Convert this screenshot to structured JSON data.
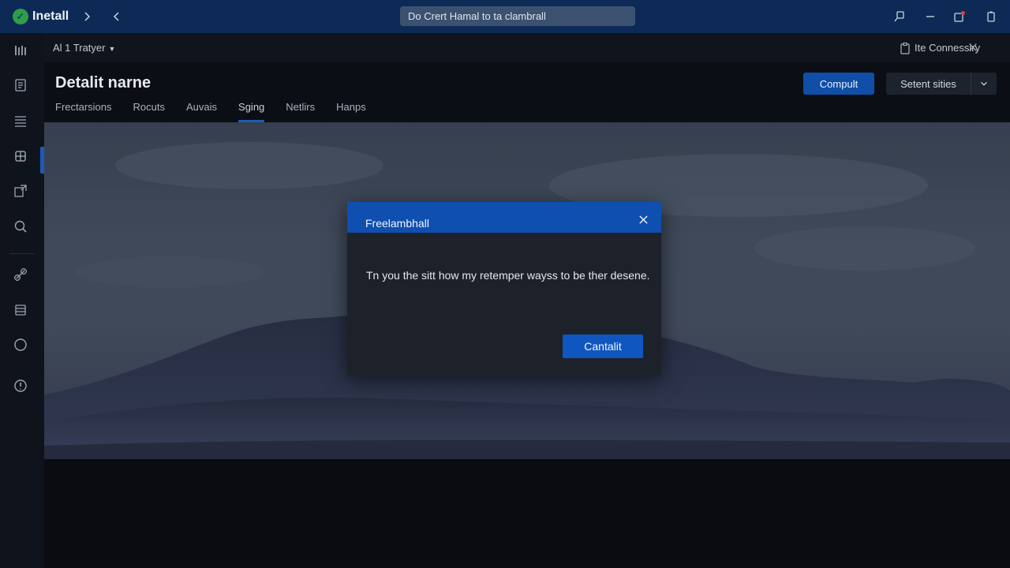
{
  "titlebar": {
    "app_name": "Inetall",
    "search_value": "Do Crert Hamal to ta clambrall"
  },
  "subheader": {
    "filter_label": "Al 1 Tratyer",
    "connect_label": "Ite Connessiry"
  },
  "page": {
    "title": "Detalit narne",
    "primary_button": "Compult",
    "split_button": "Setent sities",
    "tabs": [
      {
        "label": "Frectarsions"
      },
      {
        "label": "Rocuts"
      },
      {
        "label": "Auvais"
      },
      {
        "label": "Sging"
      },
      {
        "label": "Netlirs"
      },
      {
        "label": "Hanps"
      }
    ],
    "active_tab": "Sging"
  },
  "dialog": {
    "title": "Freelambhall",
    "message": "Tn you the sitt how my retemper wayss to be ther desene.",
    "button": "Cantalit"
  },
  "colors": {
    "titlebar": "#0c2a55",
    "accent": "#0f4fb0",
    "rail": "#0f141c",
    "dialog": "#1d222a"
  }
}
